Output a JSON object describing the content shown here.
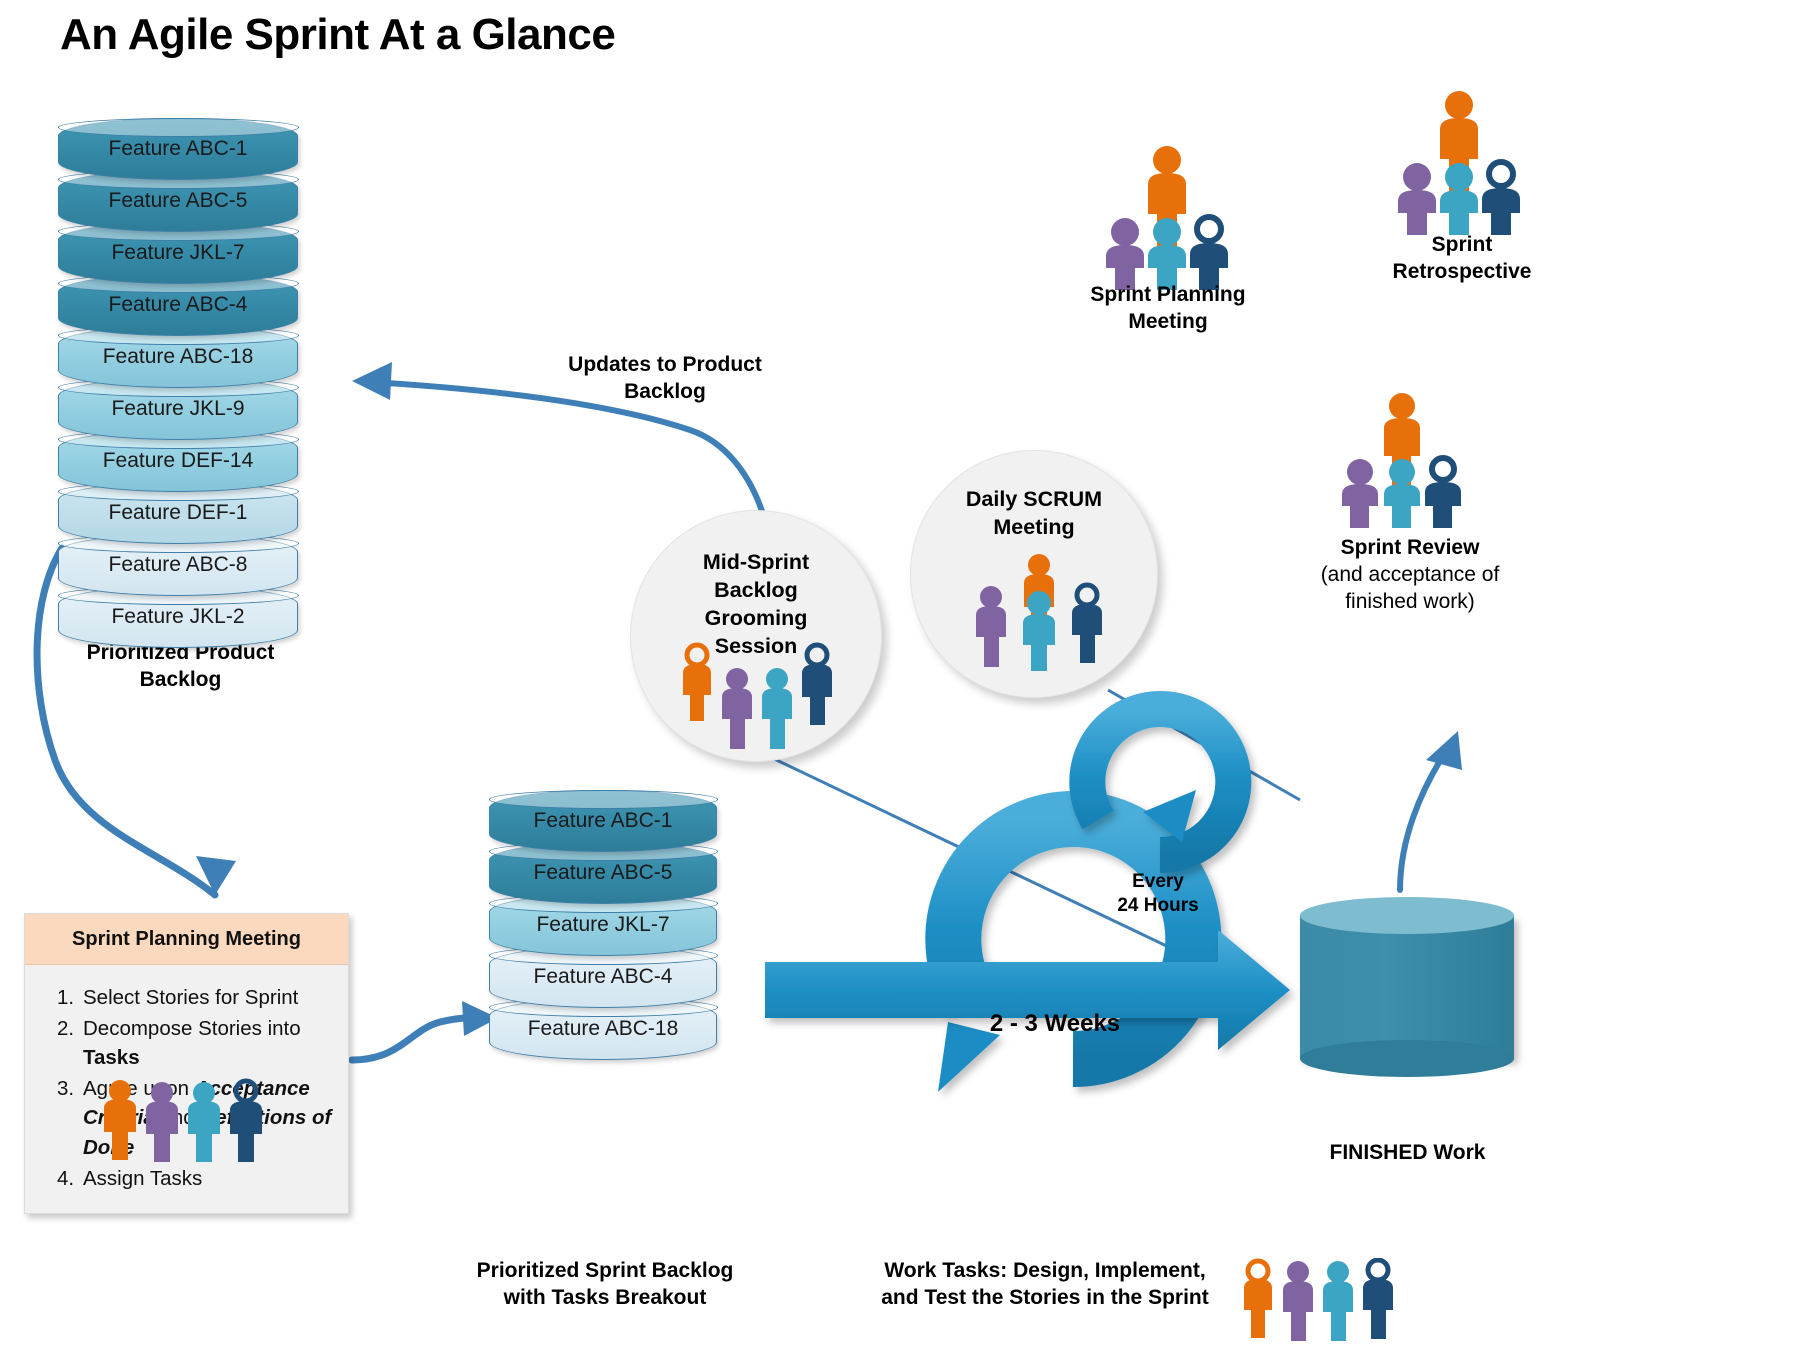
{
  "page": {
    "title": "An Agile Sprint At a Glance"
  },
  "product_backlog": {
    "caption": "Prioritized Product\nBacklog",
    "caption_line1": "Prioritized Product",
    "caption_line2": "Backlog",
    "items": [
      {
        "label": "Feature ABC-1",
        "tone": "dark"
      },
      {
        "label": "Feature ABC-5",
        "tone": "dark"
      },
      {
        "label": "Feature JKL-7",
        "tone": "dark"
      },
      {
        "label": "Feature ABC-4",
        "tone": "dark"
      },
      {
        "label": "Feature ABC-18",
        "tone": "mid"
      },
      {
        "label": "Feature JKL-9",
        "tone": "mid"
      },
      {
        "label": "Feature DEF-14",
        "tone": "mid"
      },
      {
        "label": "Feature DEF-1",
        "tone": "light"
      },
      {
        "label": "Feature ABC-8",
        "tone": "lighter"
      },
      {
        "label": "Feature JKL-2",
        "tone": "lighter"
      }
    ]
  },
  "planning_box": {
    "header": "Sprint Planning Meeting",
    "items": [
      {
        "parts": [
          {
            "t": "Select Stories for Sprint",
            "s": "plain"
          }
        ]
      },
      {
        "parts": [
          {
            "t": "Decompose Stories into ",
            "s": "plain"
          },
          {
            "t": "Tasks",
            "s": "bold"
          }
        ]
      },
      {
        "parts": [
          {
            "t": "Agree upon ",
            "s": "plain"
          },
          {
            "t": "Acceptance Criteria",
            "s": "bolditalic"
          },
          {
            "t": " and ",
            "s": "plain"
          },
          {
            "t": "Definitions of Done",
            "s": "bolditalic"
          }
        ]
      },
      {
        "parts": [
          {
            "t": "Assign Tasks",
            "s": "plain"
          }
        ]
      }
    ]
  },
  "sprint_backlog": {
    "caption_line1": "Prioritized Sprint Backlog",
    "caption_line2": "with Tasks Breakout",
    "items": [
      {
        "label": "Feature ABC-1",
        "tone": "dark"
      },
      {
        "label": "Feature ABC-5",
        "tone": "dark"
      },
      {
        "label": "Feature JKL-7",
        "tone": "mid"
      },
      {
        "label": "Feature ABC-4",
        "tone": "lighter"
      },
      {
        "label": "Feature ABC-18",
        "tone": "lighter"
      }
    ]
  },
  "flow_labels": {
    "updates_line1": "Updates to Product",
    "updates_line2": "Backlog",
    "work_tasks_line1": "Work Tasks: Design, Implement,",
    "work_tasks_line2": "and Test the Stories in the Sprint",
    "finished_work": "FINISHED Work"
  },
  "bubbles": {
    "mid_sprint": {
      "line1": "Mid-Sprint",
      "line2": "Backlog",
      "line3": "Grooming",
      "line4": "Session"
    },
    "daily_scrum": {
      "line1": "Daily SCRUM",
      "line2": "Meeting"
    }
  },
  "cycles": {
    "sprint_duration": "2 - 3 Weeks",
    "daily_line1": "Every",
    "daily_line2": "24 Hours"
  },
  "meetings": {
    "sprint_planning_line1": "Sprint Planning",
    "sprint_planning_line2": "Meeting",
    "sprint_retrospective_line1": "Sprint",
    "sprint_retrospective_line2": "Retrospective",
    "sprint_review_line1": "Sprint Review",
    "sprint_review_line2": "(and acceptance of",
    "sprint_review_line3": "finished work)"
  },
  "colors": {
    "person_orange": "#E8700A",
    "person_purple": "#8064A2",
    "person_teal": "#3DA5C4",
    "person_navy": "#1F4E79",
    "cyl_dark": "#3589A6",
    "cyl_mid": "#9BD3E3",
    "cyl_light": "#BFDEEA",
    "cyl_lighter": "#DCEBF4",
    "arrow_blue": "#3F7FB8",
    "cycle_blue": "#1B8CC4",
    "header_peach": "#FBD9BE",
    "bubble_gray": "#F1F1F1"
  }
}
